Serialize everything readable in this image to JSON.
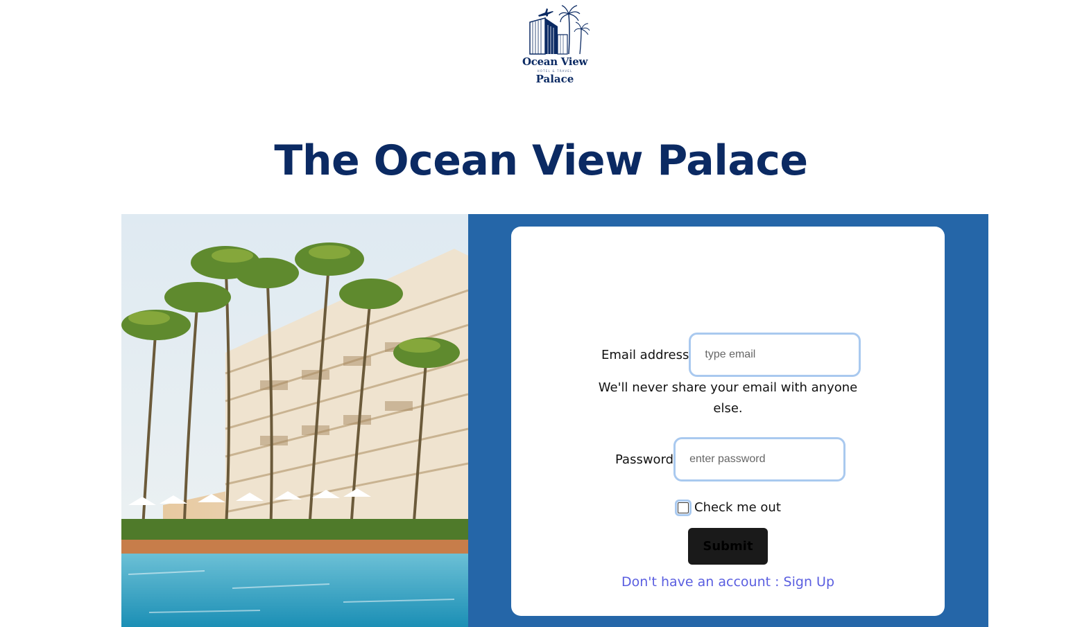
{
  "logo": {
    "line1": "Ocean View",
    "sub": "HOTEL & TRAVEL",
    "line2": "Palace"
  },
  "header": {
    "title": "The Ocean View Palace"
  },
  "form": {
    "email_label": "Email address",
    "email_placeholder": "type email",
    "email_value": "",
    "email_help": "We'll never share your email with anyone else.",
    "password_label": "Password",
    "password_placeholder": "enter password",
    "password_value": "",
    "checkbox_label": "Check me out",
    "checkbox_checked": false,
    "submit_label": "Submit",
    "signup_link": "Don't have an account : Sign Up"
  },
  "colors": {
    "brand_navy": "#0b2a63",
    "panel_blue": "#2566a8",
    "input_border": "#a9c9ef",
    "link": "#5a5ee0",
    "button": "#1a1a1a"
  },
  "icons": {
    "logo_mark": "hotel-palm-plane-icon"
  }
}
